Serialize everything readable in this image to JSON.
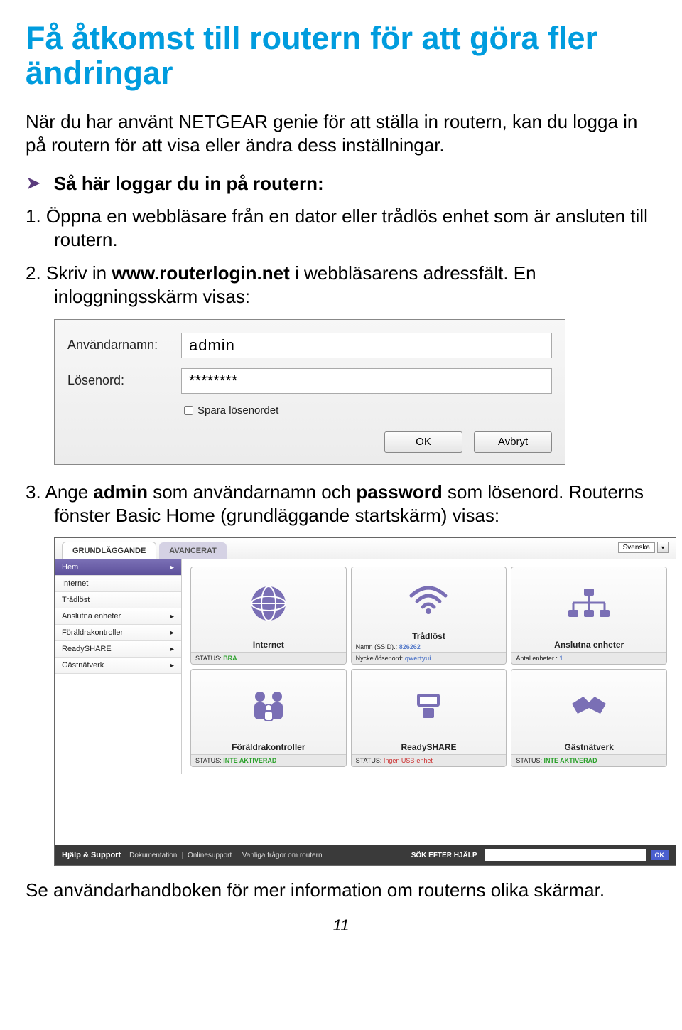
{
  "title": "Få åtkomst till routern för att göra fler ändringar",
  "intro": "När du har använt NETGEAR genie för att ställa in routern, kan du logga in på routern för att visa eller ändra dess inställningar.",
  "bullet1": "Så här loggar du in på routern:",
  "step1": "1.   Öppna en webbläsare från en dator eller trådlös enhet som är ansluten till routern.",
  "step2_pre": "2.   Skriv in ",
  "step2_url": "www.routerlogin.net",
  "step2_post": " i webbläsarens adressfält. En inloggningsskärm visas:",
  "login": {
    "username_label": "Användarnamn:",
    "password_label": "Lösenord:",
    "username_value": "admin",
    "password_value": "********",
    "save_label": "Spara lösenordet",
    "ok_label": "OK",
    "cancel_label": "Avbryt"
  },
  "step3_pre": "3.   Ange ",
  "step3_admin": "admin",
  "step3_mid": " som användarnamn och ",
  "step3_password": "password",
  "step3_post": " som lösenord. Routerns fönster Basic Home (grundläggande startskärm) visas:",
  "router": {
    "tab_basic": "GRUNDLÄGGANDE",
    "tab_adv": "AVANCERAT",
    "lang": "Svenska",
    "sidebar": [
      "Hem",
      "Internet",
      "Trådlöst",
      "Anslutna enheter",
      "Föräldrakontroller",
      "ReadySHARE",
      "Gästnätverk"
    ],
    "tiles": {
      "internet": {
        "label": "Internet",
        "status_k": "STATUS:",
        "status_v": "BRA"
      },
      "wireless": {
        "label": "Trådlöst",
        "l1k": "Namn (SSID).:",
        "l1v": "826262",
        "l2k": "Nyckel/lösenord:",
        "l2v": "qwertyui"
      },
      "devices": {
        "label": "Anslutna enheter",
        "status_k": "Antal enheter :",
        "status_v": "1"
      },
      "parental": {
        "label": "Föräldrakontroller",
        "status_k": "STATUS:",
        "status_v": "INTE AKTIVERAD"
      },
      "readyshare": {
        "label": "ReadySHARE",
        "status_k": "STATUS:",
        "status_v": "Ingen USB-enhet"
      },
      "guest": {
        "label": "Gästnätverk",
        "status_k": "STATUS:",
        "status_v": "INTE AKTIVERAD"
      }
    },
    "footer": {
      "help": "Hjälp & Support",
      "doc": "Dokumentation",
      "online": "Onlinesupport",
      "faq": "Vanliga frågor om routern",
      "search_label": "SÖK EFTER HJÄLP",
      "ok": "OK"
    }
  },
  "closing": "Se användarhandboken för mer information om routerns olika skärmar.",
  "pagenum": "11"
}
